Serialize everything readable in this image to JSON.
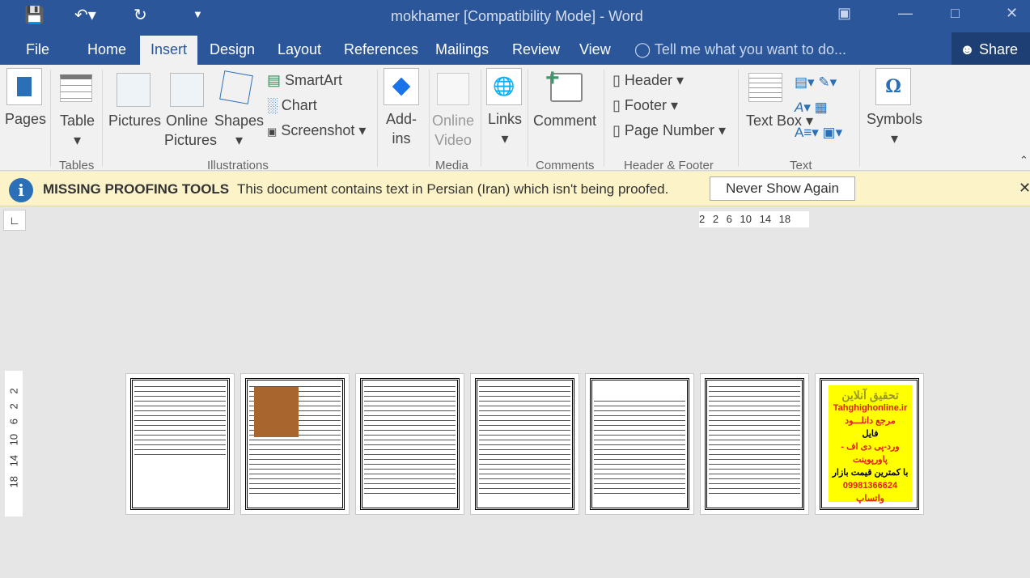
{
  "window": {
    "title": "mokhamer [Compatibility Mode] - Word",
    "share": "Share"
  },
  "tabs": [
    "File",
    "Home",
    "Insert",
    "Design",
    "Layout",
    "References",
    "Mailings",
    "Review",
    "View"
  ],
  "active_tab": "Insert",
  "tell_me": "Tell me what you want to do...",
  "ribbon": {
    "pages": "Pages",
    "table": "Table",
    "pictures": "Pictures",
    "online_pictures": "Online Pictures",
    "shapes": "Shapes",
    "smartart": "SmartArt",
    "chart": "Chart",
    "screenshot": "Screenshot",
    "addins": "Add-ins",
    "online_video": "Online Video",
    "links": "Links",
    "comment": "Comment",
    "header": "Header",
    "footer": "Footer",
    "page_number": "Page Number",
    "text_box": "Text Box",
    "symbols": "Symbols",
    "groups": {
      "tables": "Tables",
      "illustrations": "Illustrations",
      "media": "Media",
      "comments": "Comments",
      "header_footer": "Header & Footer",
      "text": "Text"
    }
  },
  "message": {
    "title": "MISSING PROOFING TOOLS",
    "text": "This document contains text in Persian (Iran) which isn't being proofed.",
    "button": "Never Show Again"
  },
  "ruler": {
    "horizontal": "2 2 6 10 14 18",
    "vertical": "18 14 10 6 2 2"
  },
  "ad_page": {
    "lines": [
      "تحقیق آنلاین",
      "Tahghighonline.ir",
      "مرجع دانلـــود",
      "فایل",
      "ورد-پی دی اف - پاورپوینت",
      "با کمترین قیمت بازار",
      "09981366624 واتساپ"
    ]
  }
}
